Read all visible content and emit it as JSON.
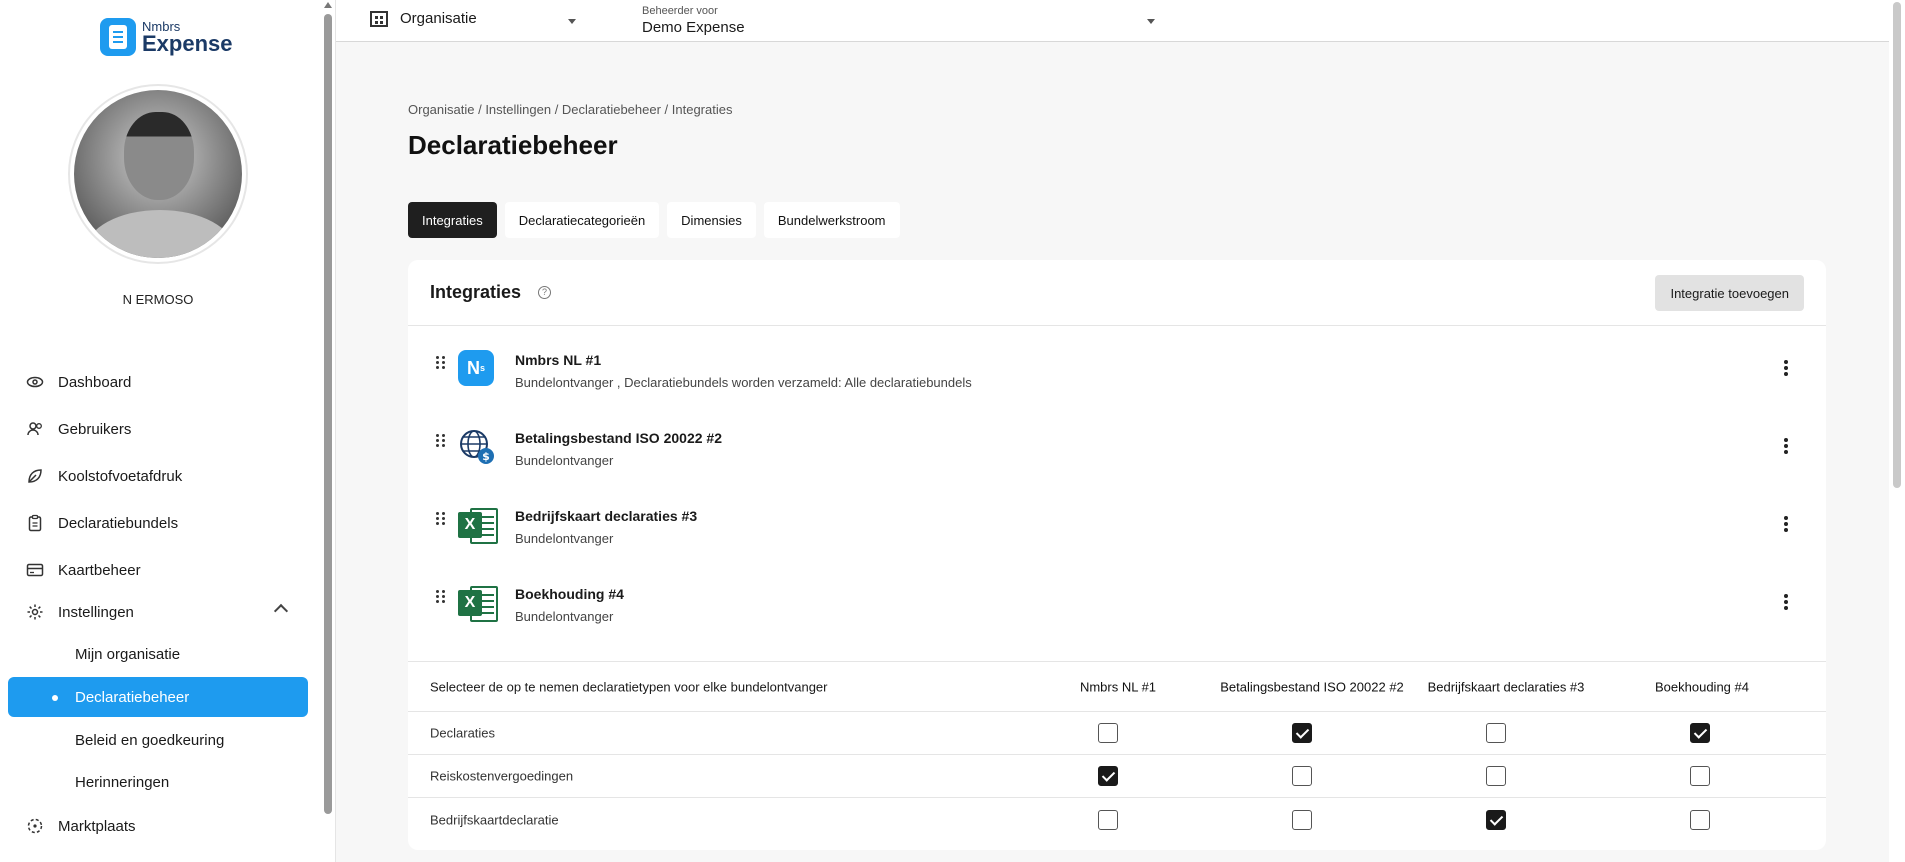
{
  "app": {
    "brand_small": "Nmbrs",
    "brand_big": "Expense",
    "accent_color": "#1e9bef"
  },
  "user": {
    "name": "N ERMOSO"
  },
  "topbar": {
    "organisation": "Organisatie",
    "admin_label": "Beheerder voor",
    "admin_value": "Demo Expense"
  },
  "nav": {
    "items": [
      {
        "label": "Dashboard",
        "icon": "eye-icon"
      },
      {
        "label": "Gebruikers",
        "icon": "users-icon"
      },
      {
        "label": "Koolstofvoetafdruk",
        "icon": "leaf-icon"
      },
      {
        "label": "Declaratiebundels",
        "icon": "clipboard-icon"
      },
      {
        "label": "Kaartbeheer",
        "icon": "card-icon"
      },
      {
        "label": "Instellingen",
        "icon": "gear-icon"
      },
      {
        "label": "Marktplaats",
        "icon": "marketplace-icon"
      }
    ],
    "subitems": [
      {
        "label": "Mijn organisatie"
      },
      {
        "label": "Declaratiebeheer"
      },
      {
        "label": "Beleid en goedkeuring"
      },
      {
        "label": "Herinneringen"
      }
    ]
  },
  "main": {
    "breadcrumb": "Organisatie / Instellingen / Declaratiebeheer / Integraties",
    "title": "Declaratiebeheer",
    "tabs": [
      {
        "label": "Integraties"
      },
      {
        "label": "Declaratiecategorieën"
      },
      {
        "label": "Dimensies"
      },
      {
        "label": "Bundelwerkstroom"
      }
    ],
    "card_title": "Integraties",
    "add_button": "Integratie toevoegen",
    "integrations": [
      {
        "name": "Nmbrs NL #1",
        "desc": "Bundelontvanger , Declaratiebundels worden verzameld: Alle declaratiebundels",
        "icon": "nmbrs-icon",
        "icon_text": "N"
      },
      {
        "name": "Betalingsbestand ISO 20022 #2",
        "desc": "Bundelontvanger",
        "icon": "globe-dollar-icon"
      },
      {
        "name": "Bedrijfskaart declaraties #3",
        "desc": "Bundelontvanger",
        "icon": "excel-icon",
        "icon_text": "X"
      },
      {
        "name": "Boekhouding #4",
        "desc": "Bundelontvanger",
        "icon": "excel-icon",
        "icon_text": "X"
      }
    ],
    "matrix": {
      "header_label": "Selecteer de op te nemen declaratietypen voor elke bundelontvanger",
      "columns": [
        "Nmbrs NL #1",
        "Betalingsbestand ISO 20022 #2",
        "Bedrijfskaart declaraties #3",
        "Boekhouding #4"
      ],
      "rows": [
        {
          "label": "Declaraties",
          "checked": [
            false,
            true,
            false,
            true
          ]
        },
        {
          "label": "Reiskostenvergoedingen",
          "checked": [
            true,
            false,
            false,
            false
          ]
        },
        {
          "label": "Bedrijfskaartdeclaratie",
          "checked": [
            false,
            false,
            true,
            false
          ]
        }
      ]
    }
  }
}
